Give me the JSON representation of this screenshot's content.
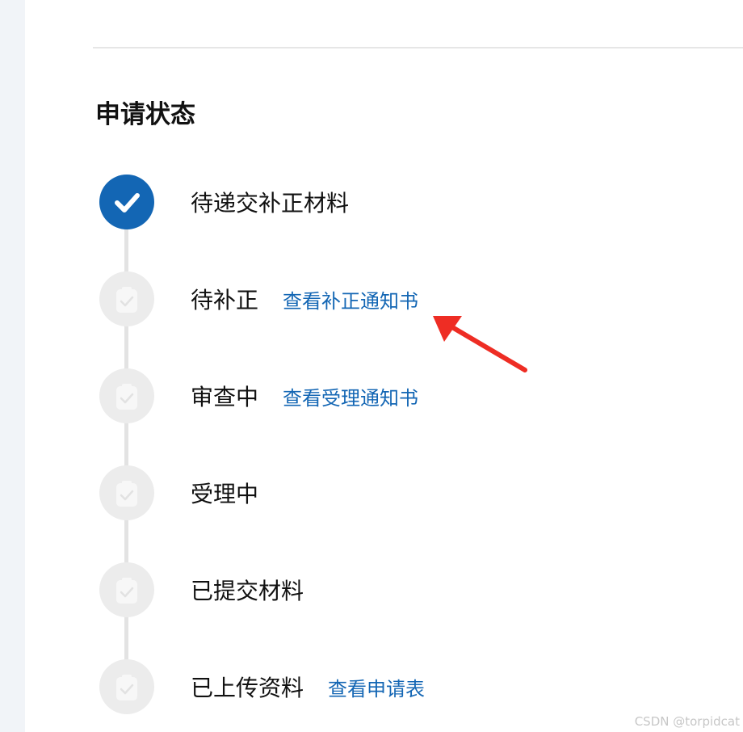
{
  "section": {
    "title": "申请状态"
  },
  "steps": [
    {
      "label": "待递交补正材料",
      "link": "",
      "status": "done"
    },
    {
      "label": "待补正",
      "link": "查看补正通知书",
      "status": "pending"
    },
    {
      "label": "审查中",
      "link": "查看受理通知书",
      "status": "pending"
    },
    {
      "label": "受理中",
      "link": "",
      "status": "pending"
    },
    {
      "label": "已提交材料",
      "link": "",
      "status": "pending"
    },
    {
      "label": "已上传资料",
      "link": "查看申请表",
      "status": "pending"
    }
  ],
  "icons": {
    "done": "checkmark-icon",
    "pending": "clipboard-check-icon"
  },
  "colors": {
    "accent": "#1366b4",
    "pending_circle": "#ececec",
    "annotation_arrow": "#ee2d24"
  },
  "watermark": "CSDN @torpidcat"
}
